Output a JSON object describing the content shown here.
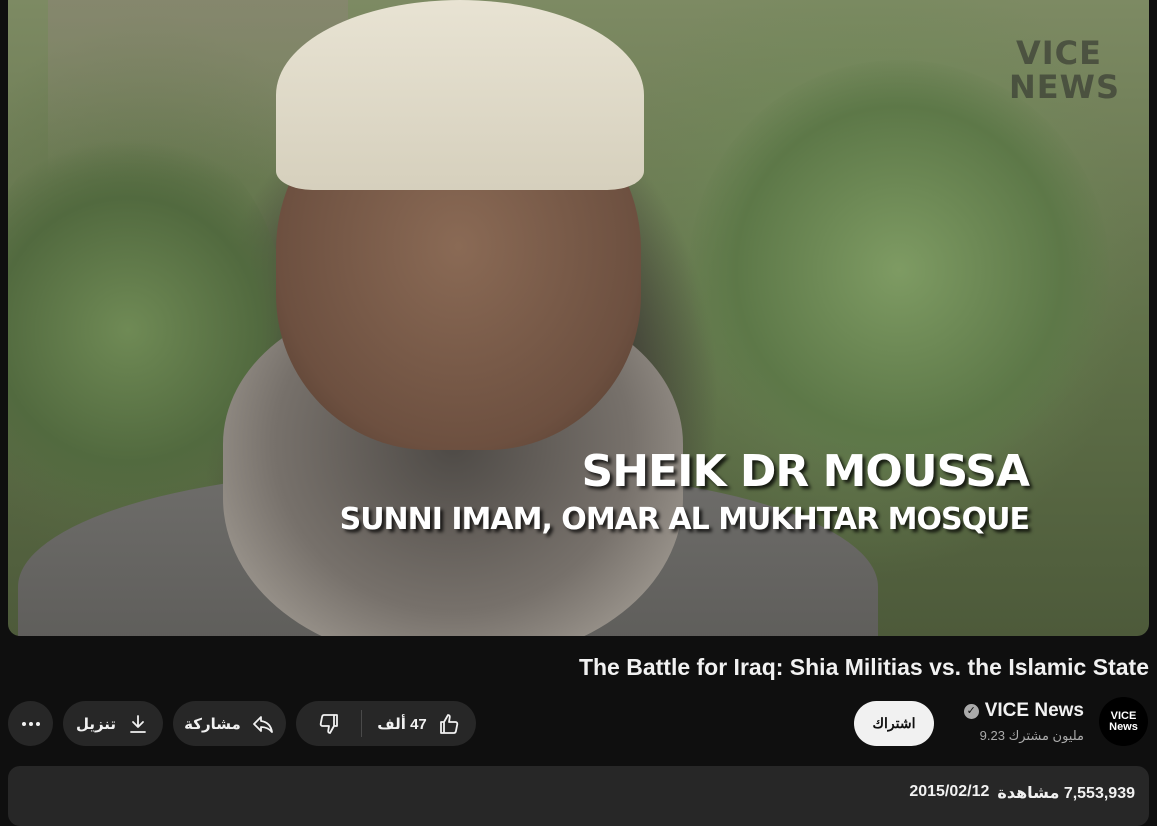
{
  "video": {
    "watermark_line1": "VICE",
    "watermark_line2": "NEWS",
    "lower_third_name": "SHEIK DR MOUSSA",
    "lower_third_role": "SUNNI IMAM, OMAR AL MUKHTAR MOSQUE"
  },
  "title": "The Battle for Iraq: Shia Militias vs. the Islamic State",
  "channel": {
    "name": "VICE News",
    "subscribers": "9.23 مليون مشترك",
    "avatar_line1": "VICE",
    "avatar_line2": "News",
    "verified": true
  },
  "actions": {
    "subscribe_label": "اشتراك",
    "like_count": "47 ألف",
    "share_label": "مشاركة",
    "download_label": "تنزيل"
  },
  "description": {
    "views": "7,553,939 مشاهدة",
    "date": "2015/02/12"
  },
  "colors": {
    "background": "#0f0f0f",
    "pill": "#272727",
    "subscribe_bg": "#f1f1f1",
    "text_secondary": "#aaaaaa"
  }
}
